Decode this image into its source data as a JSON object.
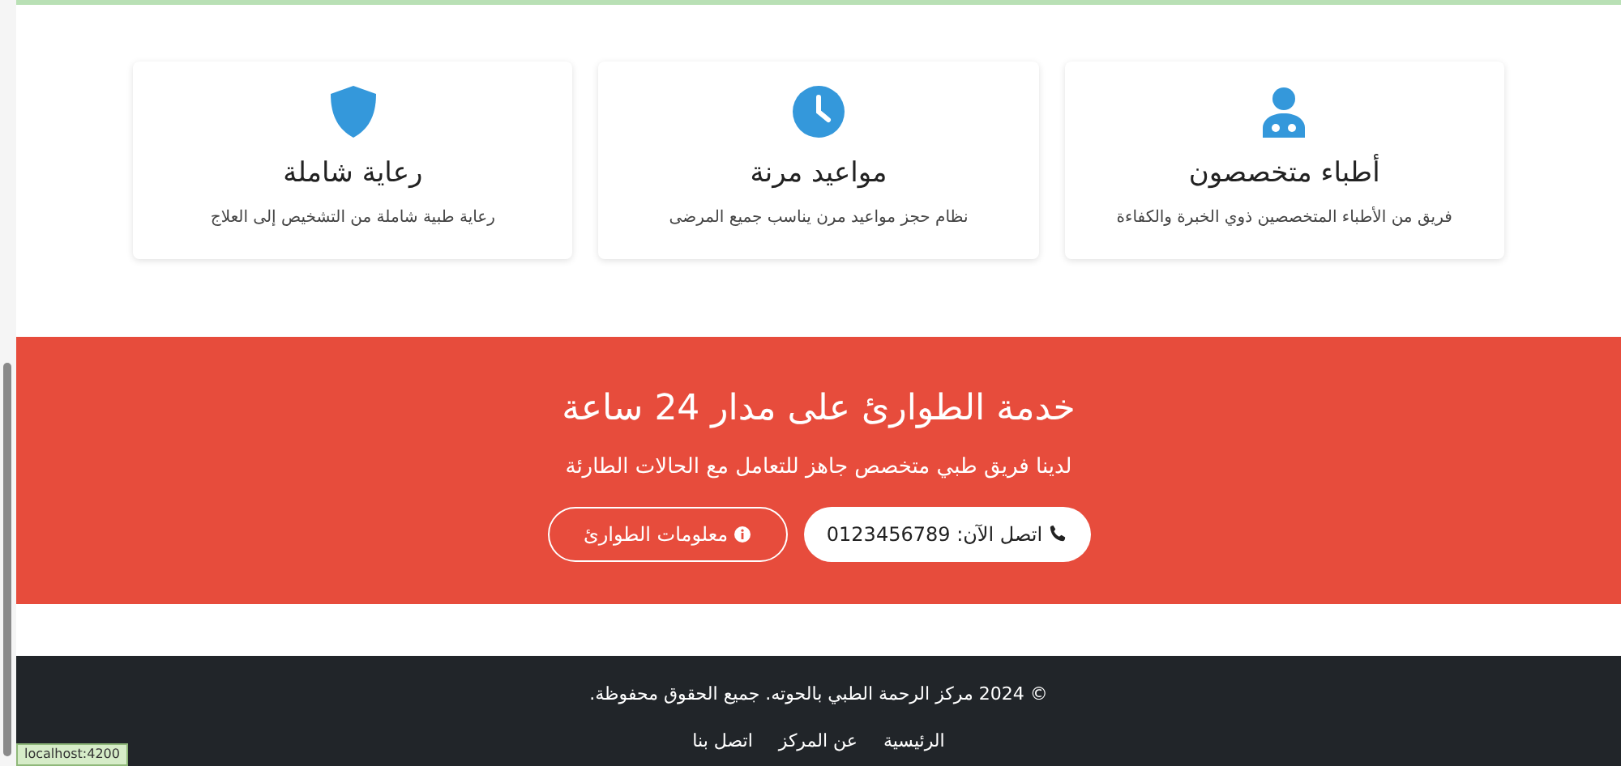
{
  "features": [
    {
      "kind": "doctor",
      "title": "أطباء متخصصون",
      "text": "فريق من الأطباء المتخصصين ذوي الخبرة والكفاءة"
    },
    {
      "kind": "clock",
      "title": "مواعيد مرنة",
      "text": "نظام حجز مواعيد مرن يناسب جميع المرضى"
    },
    {
      "kind": "shield",
      "title": "رعاية شاملة",
      "text": "رعاية طبية شاملة من التشخيص إلى العلاج"
    }
  ],
  "emergency": {
    "title": "خدمة الطوارئ على مدار 24 ساعة",
    "text": "لدينا فريق طبي متخصص جاهز للتعامل مع الحالات الطارئة",
    "buttons": [
      {
        "kind": "call",
        "label": "اتصل الآن: 0123456789"
      },
      {
        "kind": "info",
        "label": "معلومات الطوارئ"
      }
    ]
  },
  "footer": {
    "copyright": "© 2024 مركز الرحمة الطبي بالحوته. جميع الحقوق محفوظة.",
    "links": [
      "الرئيسية",
      "عن المركز",
      "اتصل بنا"
    ]
  },
  "status_bar": {
    "url": "localhost:4200"
  }
}
